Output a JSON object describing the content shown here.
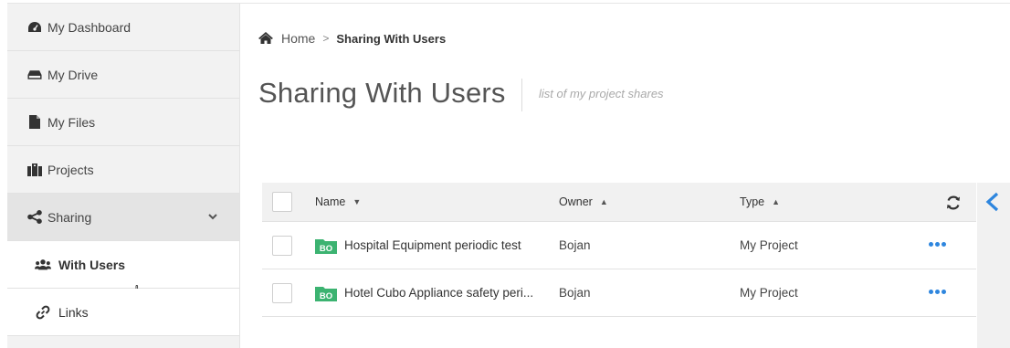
{
  "sidebar": {
    "items": [
      {
        "label": "My Dashboard",
        "icon": "dashboard-icon"
      },
      {
        "label": "My Drive",
        "icon": "drive-icon"
      },
      {
        "label": "My Files",
        "icon": "file-icon"
      },
      {
        "label": "Projects",
        "icon": "projects-icon"
      },
      {
        "label": "Sharing",
        "icon": "share-icon"
      }
    ],
    "subitems": [
      {
        "label": "With Users",
        "icon": "users-icon"
      },
      {
        "label": "Links",
        "icon": "link-icon"
      }
    ]
  },
  "breadcrumb": {
    "home": "Home",
    "separator": ">",
    "current": "Sharing With Users"
  },
  "page": {
    "title": "Sharing With Users",
    "subtitle": "list of my project shares"
  },
  "table": {
    "columns": {
      "name": "Name",
      "owner": "Owner",
      "type": "Type"
    },
    "rows": [
      {
        "badge": "BO",
        "name": "Hospital Equipment periodic test",
        "owner": "Bojan",
        "type": "My Project"
      },
      {
        "badge": "BO",
        "name": "Hotel Cubo Appliance safety peri...",
        "owner": "Bojan",
        "type": "My Project"
      }
    ]
  },
  "colors": {
    "accent": "#2e86de",
    "folder_green": "#3cb371",
    "sidebar_bg": "#f2f2f2"
  }
}
